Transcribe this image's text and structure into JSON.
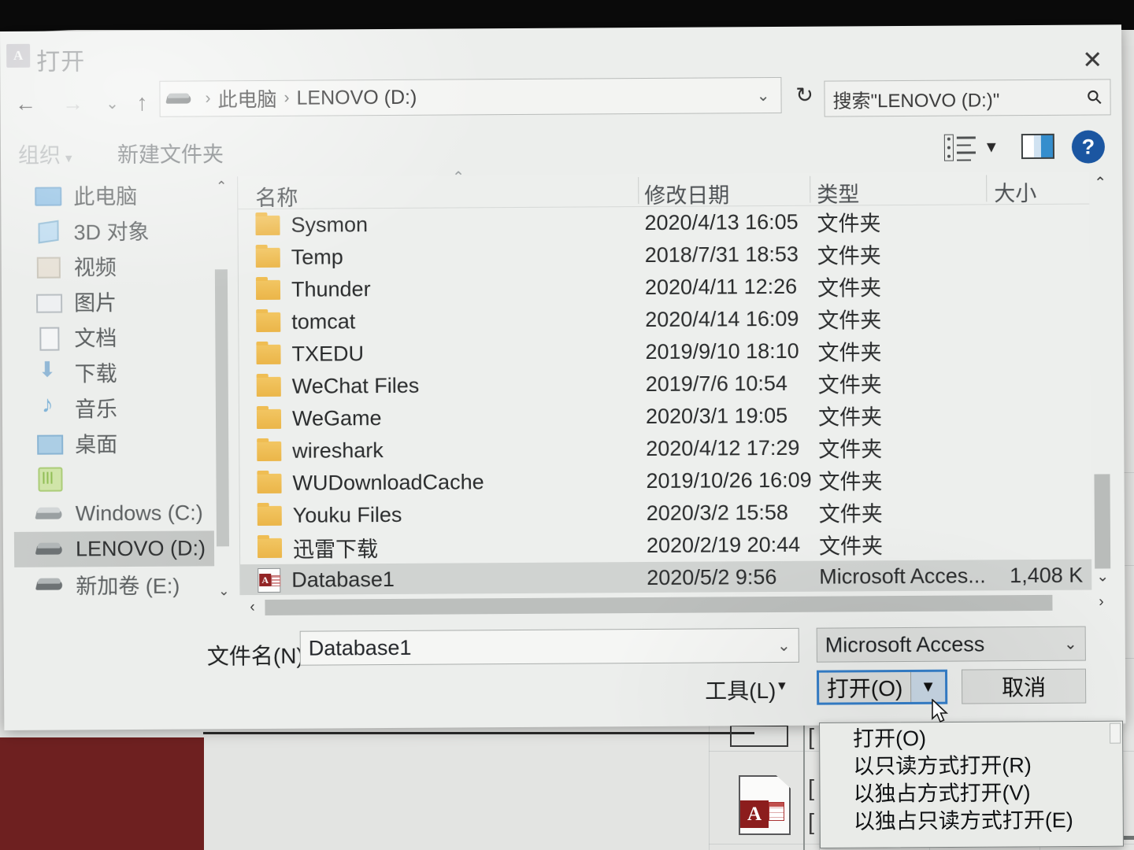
{
  "window": {
    "title": "打开",
    "app_icon": "access-icon",
    "close_label": "✕"
  },
  "nav": {
    "back": "←",
    "forward": "→",
    "recent": "⌄",
    "up": "↑"
  },
  "address": {
    "drive_icon": "drive-icon",
    "crumbs": [
      "此电脑",
      "LENOVO (D:)"
    ],
    "separator": "›",
    "chevron": "⌄",
    "refresh": "↻"
  },
  "search": {
    "placeholder": "搜索\"LENOVO (D:)\"",
    "icon": "search-icon"
  },
  "commandbar": {
    "organize": "组织",
    "organize_caret": "▾",
    "new_folder": "新建文件夹",
    "view_caret": "▼",
    "help": "?"
  },
  "sidebar": {
    "items": [
      {
        "label": "此电脑",
        "icon": "pc-icon",
        "selected": false
      },
      {
        "label": "3D 对象",
        "icon": "3d-objects-icon",
        "selected": false
      },
      {
        "label": "视频",
        "icon": "videos-icon",
        "selected": false
      },
      {
        "label": "图片",
        "icon": "pictures-icon",
        "selected": false
      },
      {
        "label": "文档",
        "icon": "documents-icon",
        "selected": false
      },
      {
        "label": "下载",
        "icon": "downloads-icon",
        "selected": false
      },
      {
        "label": "音乐",
        "icon": "music-icon",
        "selected": false
      },
      {
        "label": "桌面",
        "icon": "desktop-icon",
        "selected": false
      },
      {
        "label": "",
        "icon": "green-drive-icon",
        "selected": false
      },
      {
        "label": "Windows (C:)",
        "icon": "drive-icon",
        "selected": false
      },
      {
        "label": "LENOVO (D:)",
        "icon": "drive-icon",
        "selected": true
      },
      {
        "label": "新加卷 (E:)",
        "icon": "drive-icon",
        "selected": false
      }
    ],
    "scroll_up": "⌃",
    "scroll_down": "⌄"
  },
  "filelist": {
    "columns": [
      "名称",
      "修改日期",
      "类型",
      "大小"
    ],
    "sort_indicator": "⌃",
    "rows": [
      {
        "name": "Sysmon",
        "date": "2020/4/13 16:05",
        "type": "文件夹",
        "size": "",
        "icon": "folder-icon",
        "selected": false
      },
      {
        "name": "Temp",
        "date": "2018/7/31 18:53",
        "type": "文件夹",
        "size": "",
        "icon": "folder-icon",
        "selected": false
      },
      {
        "name": "Thunder",
        "date": "2020/4/11 12:26",
        "type": "文件夹",
        "size": "",
        "icon": "folder-icon",
        "selected": false
      },
      {
        "name": "tomcat",
        "date": "2020/4/14 16:09",
        "type": "文件夹",
        "size": "",
        "icon": "folder-icon",
        "selected": false
      },
      {
        "name": "TXEDU",
        "date": "2019/9/10 18:10",
        "type": "文件夹",
        "size": "",
        "icon": "folder-icon",
        "selected": false
      },
      {
        "name": "WeChat Files",
        "date": "2019/7/6 10:54",
        "type": "文件夹",
        "size": "",
        "icon": "folder-icon",
        "selected": false
      },
      {
        "name": "WeGame",
        "date": "2020/3/1 19:05",
        "type": "文件夹",
        "size": "",
        "icon": "folder-icon",
        "selected": false
      },
      {
        "name": "wireshark",
        "date": "2020/4/12 17:29",
        "type": "文件夹",
        "size": "",
        "icon": "folder-icon",
        "selected": false
      },
      {
        "name": "WUDownloadCache",
        "date": "2019/10/26 16:09",
        "type": "文件夹",
        "size": "",
        "icon": "folder-icon",
        "selected": false
      },
      {
        "name": "Youku Files",
        "date": "2020/3/2 15:58",
        "type": "文件夹",
        "size": "",
        "icon": "folder-icon",
        "selected": false
      },
      {
        "name": "迅雷下载",
        "date": "2020/2/19 20:44",
        "type": "文件夹",
        "size": "",
        "icon": "folder-icon",
        "selected": false
      },
      {
        "name": "Database1",
        "date": "2020/5/2 9:56",
        "type": "Microsoft Acces...",
        "size": "1,408 K",
        "icon": "access-file-icon",
        "selected": true
      }
    ],
    "scroll_up": "⌃",
    "scroll_down": "⌄",
    "scroll_left": "‹",
    "scroll_right": "›"
  },
  "footer": {
    "filename_label": "文件名(N):",
    "filename_value": "Database1",
    "filename_chevron": "⌄",
    "filetype_value": "Microsoft Access",
    "filetype_chevron": "⌄",
    "tools_label": "工具(L)",
    "tools_caret": "▾",
    "open_label": "打开(O)",
    "open_caret": "▼",
    "cancel_label": "取消"
  },
  "open_menu": {
    "items": [
      "打开(O)",
      "以只读方式打开(R)",
      "以独占方式打开(V)",
      "以独占只读方式打开(E)"
    ]
  },
  "colors": {
    "accent_blue": "#2f7fd0",
    "help_blue": "#1657a8",
    "folder_yellow": "#f3bd49",
    "access_red": "#9a2222",
    "selection_gray": "#d0d3d1",
    "wallpaper_red": "#6e2020"
  }
}
